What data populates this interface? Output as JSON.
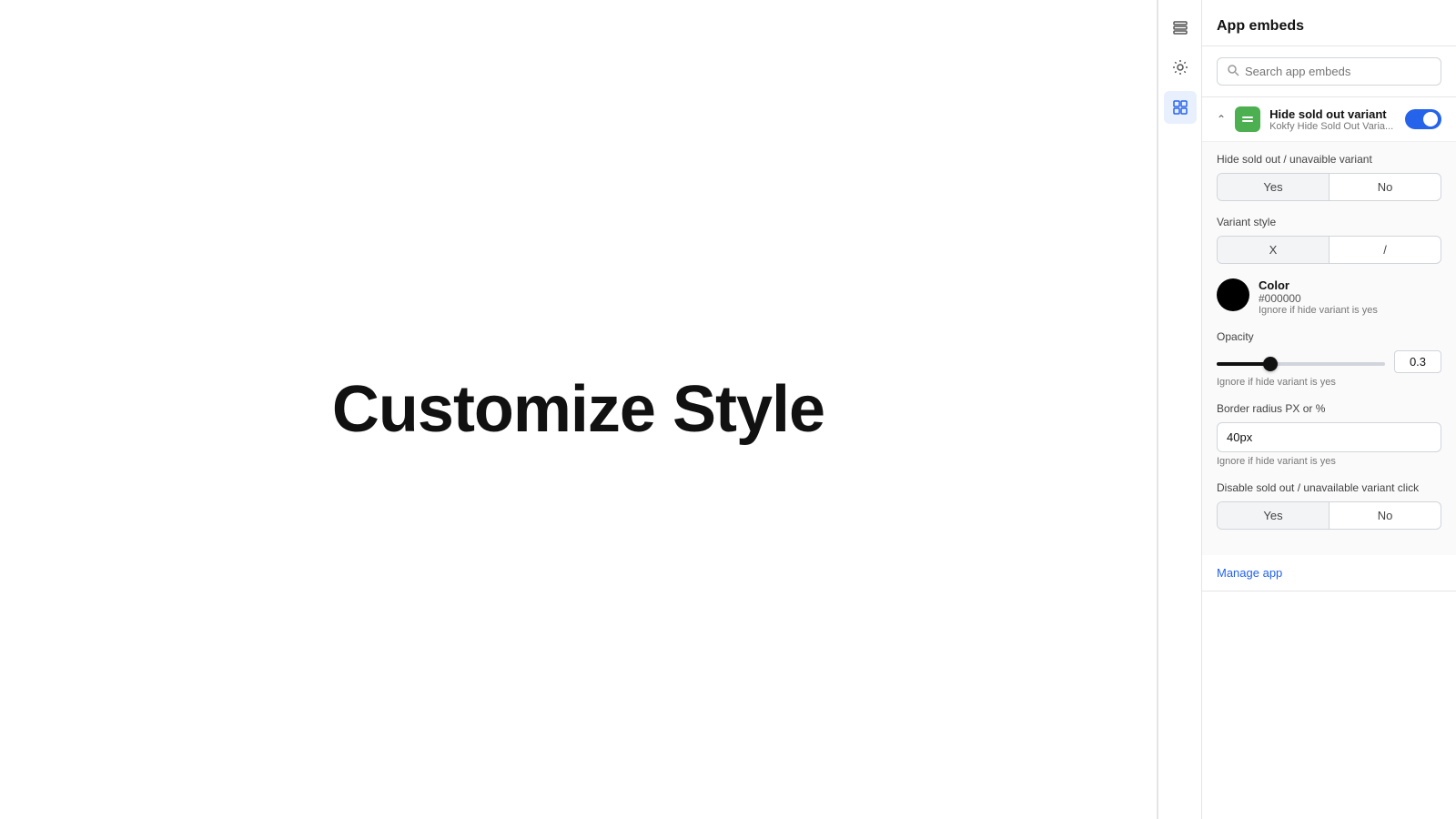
{
  "canvas": {
    "title": "Customize Style"
  },
  "toolbar": {
    "icons": [
      {
        "name": "layers-icon",
        "symbol": "⊟",
        "active": false
      },
      {
        "name": "settings-icon",
        "symbol": "⚙",
        "active": false
      },
      {
        "name": "apps-icon",
        "symbol": "⊞",
        "active": true
      }
    ]
  },
  "panel": {
    "title": "App embeds",
    "search": {
      "placeholder": "Search app embeds"
    },
    "embed": {
      "name": "Hide sold out variant",
      "subtitle": "Kokfy Hide Sold Out Varia...",
      "enabled": true,
      "settings": {
        "hide_sold_out_label": "Hide sold out / unavaible variant",
        "hide_sold_out_yes": "Yes",
        "hide_sold_out_no": "No",
        "hide_sold_out_active": "yes",
        "variant_style_label": "Variant style",
        "variant_style_x": "X",
        "variant_style_slash": "/",
        "variant_style_active": "x",
        "color_label": "Color",
        "color_hex": "#000000",
        "color_note": "Ignore if hide variant is yes",
        "opacity_label": "Opacity",
        "opacity_value": "0.3",
        "opacity_note": "Ignore if hide variant is yes",
        "border_radius_label": "Border radius PX or %",
        "border_radius_value": "40px",
        "border_radius_note": "Ignore if hide variant is yes",
        "disable_label": "Disable sold out / unavailable variant click",
        "disable_yes": "Yes",
        "disable_no": "No",
        "disable_active": "yes"
      }
    },
    "manage_app_link": "Manage app"
  }
}
